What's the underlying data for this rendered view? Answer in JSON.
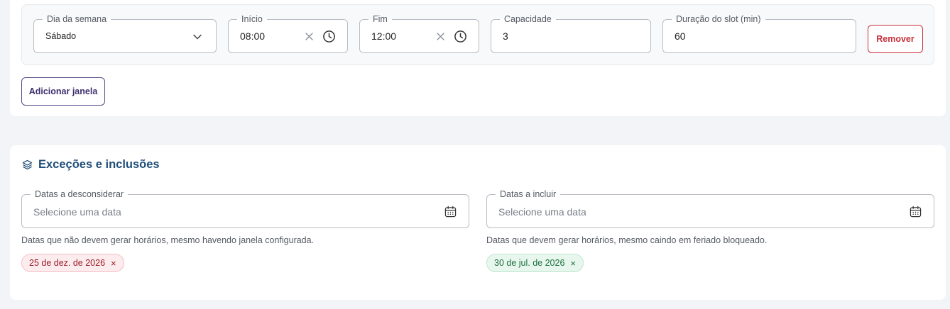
{
  "windows": {
    "row": {
      "day": {
        "label": "Dia da semana",
        "value": "Sábado"
      },
      "start": {
        "label": "Início",
        "value": "08:00"
      },
      "end": {
        "label": "Fim",
        "value": "12:00"
      },
      "capacity": {
        "label": "Capacidade",
        "value": "3"
      },
      "slot_duration": {
        "label": "Duração do slot (min)",
        "value": "60"
      },
      "remove_label": "Remover"
    },
    "add_label": "Adicionar janela"
  },
  "exceptions": {
    "title": "Exceções e inclusões",
    "exclude": {
      "label": "Datas a desconsiderar",
      "placeholder": "Selecione uma data",
      "helper": "Datas que não devem gerar horários, mesmo havendo janela configurada.",
      "chips": [
        "25 de dez. de 2026"
      ]
    },
    "include": {
      "label": "Datas a incluir",
      "placeholder": "Selecione uma data",
      "helper": "Datas que devem gerar horários, mesmo caindo em feriado bloqueado.",
      "chips": [
        "30 de jul. de 2026"
      ]
    }
  },
  "colors": {
    "accent_title": "#1f4e79",
    "danger": "#c8303a",
    "primary_outline": "#5a4b8a",
    "chip_exclude_bg": "#fdecee",
    "chip_include_bg": "#e8f7ee"
  },
  "icons": {
    "clear": "close-icon",
    "time": "clock-icon",
    "dropdown": "chevron-down-icon",
    "date": "calendar-icon",
    "section": "layers-icon"
  }
}
